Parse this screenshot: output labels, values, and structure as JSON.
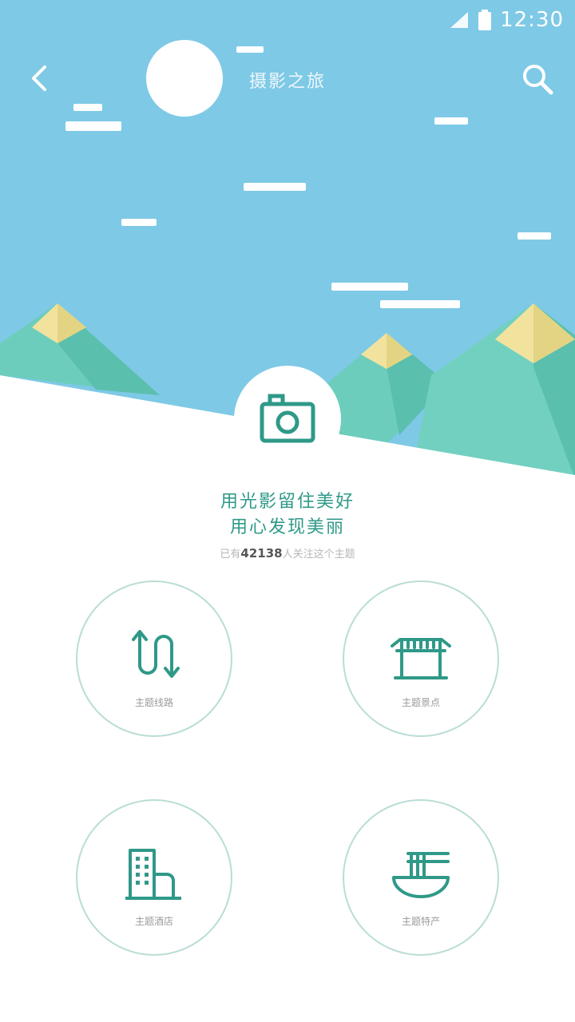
{
  "status_bar": {
    "time": "12:30"
  },
  "header": {
    "title": "摄影之旅"
  },
  "slogan": {
    "line1": "用光影留住美好",
    "line2": "用心发现美丽"
  },
  "stat": {
    "prefix": "已有",
    "count": "42138",
    "suffix": "人关注这个主题"
  },
  "menu": [
    {
      "label": "主题线路",
      "icon": "route-icon"
    },
    {
      "label": "主题景点",
      "icon": "landmark-icon"
    },
    {
      "label": "主题酒店",
      "icon": "hotel-icon"
    },
    {
      "label": "主题特产",
      "icon": "noodle-bowl-icon"
    }
  ],
  "colors": {
    "sky": "#7ec9e6",
    "accent": "#2f9988",
    "mountain": "#6dcdbd",
    "peak": "#f1e39e"
  }
}
